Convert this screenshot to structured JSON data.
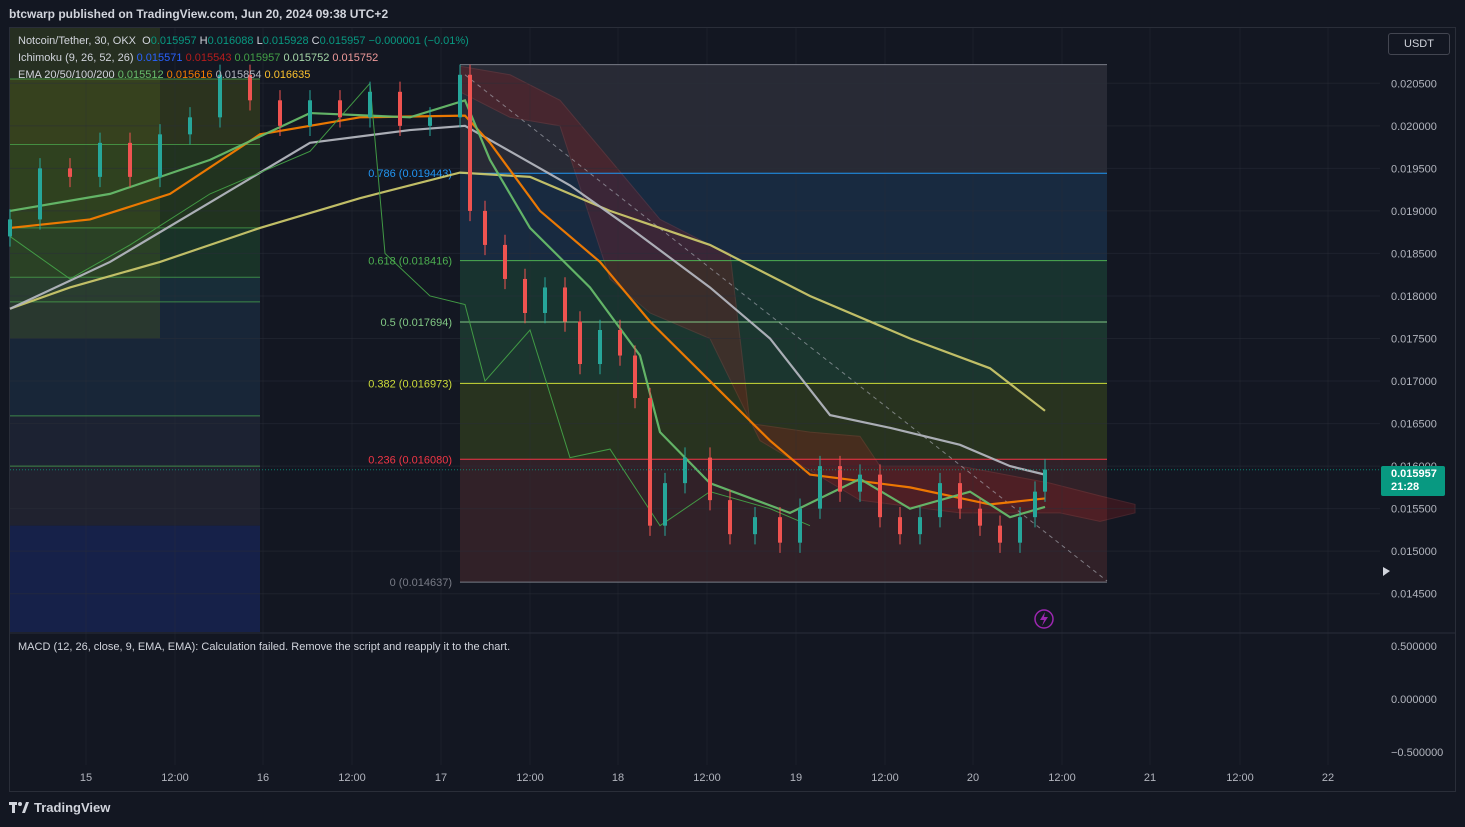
{
  "header": {
    "published_line": "btcwarp published on TradingView.com, Jun 20, 2024 09:38 UTC+2"
  },
  "legend": {
    "symbol": "Notcoin/Tether, 30, OKX",
    "o_label": "O",
    "o_value": "0.015957",
    "h_label": "H",
    "h_value": "0.016088",
    "l_label": "L",
    "l_value": "0.015928",
    "c_label": "C",
    "c_value": "0.015957",
    "change": "−0.000001 (−0.01%)",
    "ichimoku_label": "Ichimoku (9, 26, 52, 26)",
    "ichimoku_values": [
      {
        "v": "0.015571",
        "color": "#2962ff"
      },
      {
        "v": "0.015543",
        "color": "#b71c1c"
      },
      {
        "v": "0.015957",
        "color": "#43a047"
      },
      {
        "v": "0.015752",
        "color": "#a5d6a7"
      },
      {
        "v": "0.015752",
        "color": "#ef9a9a"
      }
    ],
    "ema_label": "EMA 20/50/100/200",
    "ema_values": [
      {
        "v": "0.015512",
        "color": "#66bb6a"
      },
      {
        "v": "0.015616",
        "color": "#f57c00"
      },
      {
        "v": "0.015854",
        "color": "#b2b5be"
      },
      {
        "v": "0.016635",
        "color": "#fbc02d"
      }
    ],
    "macd_text": "MACD (12, 26, close, 9, EMA, EMA): Calculation failed. Remove the script and reapply it to the chart."
  },
  "currency_button": "USDT",
  "last_price": {
    "value": "0.015957",
    "countdown": "21:28",
    "color": "#089981"
  },
  "footer": {
    "logo_text": "TradingView"
  },
  "chart_data": {
    "type": "line",
    "y_axis": {
      "ticks": [
        "0.020500",
        "0.020000",
        "0.019500",
        "0.019000",
        "0.018500",
        "0.018000",
        "0.017500",
        "0.017000",
        "0.016500",
        "0.016000",
        "0.015500",
        "0.015000",
        "0.014500"
      ],
      "tick_values": [
        0.0205,
        0.02,
        0.0195,
        0.019,
        0.0185,
        0.018,
        0.0175,
        0.017,
        0.0165,
        0.016,
        0.0155,
        0.015,
        0.0145
      ],
      "ylim": [
        0.01405,
        0.02115
      ]
    },
    "x_axis": {
      "ticks": [
        "15",
        "12:00",
        "16",
        "12:00",
        "17",
        "12:00",
        "18",
        "12:00",
        "19",
        "12:00",
        "20",
        "12:00",
        "21",
        "12:00",
        "22"
      ]
    },
    "macd_axis": {
      "ticks": [
        "0.500000",
        "0.000000",
        "−0.500000"
      ]
    },
    "fib_left": {
      "levels": [
        0.02055,
        0.01978,
        0.0188,
        0.01822,
        0.01793,
        0.01659,
        0.016,
        0.0153
      ]
    },
    "fib_right": {
      "levels": [
        {
          "ratio": "",
          "label": "",
          "value": 0.02072,
          "color": "#787b86"
        },
        {
          "ratio": "0.786",
          "label": "0.786 (0.019443)",
          "value": 0.019443,
          "color": "#2196f3"
        },
        {
          "ratio": "0.618",
          "label": "0.618 (0.018416)",
          "value": 0.018416,
          "color": "#4caf50"
        },
        {
          "ratio": "0.5",
          "label": "0.5 (0.017694)",
          "value": 0.017694,
          "color": "#81c784"
        },
        {
          "ratio": "0.382",
          "label": "0.382 (0.016973)",
          "value": 0.016973,
          "color": "#cddc39"
        },
        {
          "ratio": "0.236",
          "label": "0.236 (0.016080)",
          "value": 0.01608,
          "color": "#f23645"
        },
        {
          "ratio": "0",
          "label": "0 (0.014637)",
          "value": 0.014637,
          "color": "#787b86"
        }
      ]
    },
    "series": [
      {
        "name": "EMA 200",
        "color": "#c9c66a",
        "points": [
          [
            0,
            0.01785
          ],
          [
            60,
            0.0181
          ],
          [
            150,
            0.0184
          ],
          [
            250,
            0.0188
          ],
          [
            350,
            0.01915
          ],
          [
            450,
            0.01945
          ],
          [
            520,
            0.0194
          ],
          [
            600,
            0.019
          ],
          [
            700,
            0.0186
          ],
          [
            800,
            0.018
          ],
          [
            900,
            0.0175
          ],
          [
            980,
            0.01715
          ],
          [
            1035,
            0.01665
          ]
        ]
      },
      {
        "name": "EMA 100",
        "color": "#b2b5be",
        "points": [
          [
            0,
            0.01785
          ],
          [
            100,
            0.0184
          ],
          [
            200,
            0.0191
          ],
          [
            300,
            0.0198
          ],
          [
            400,
            0.01995
          ],
          [
            455,
            0.02
          ],
          [
            500,
            0.0197
          ],
          [
            560,
            0.0193
          ],
          [
            620,
            0.0188
          ],
          [
            700,
            0.0181
          ],
          [
            760,
            0.0175
          ],
          [
            820,
            0.0166
          ],
          [
            880,
            0.01645
          ],
          [
            950,
            0.01625
          ],
          [
            1000,
            0.016
          ],
          [
            1035,
            0.0159
          ]
        ]
      },
      {
        "name": "EMA 50",
        "color": "#f57c00",
        "points": [
          [
            0,
            0.0188
          ],
          [
            80,
            0.0189
          ],
          [
            160,
            0.0192
          ],
          [
            250,
            0.0199
          ],
          [
            350,
            0.0201
          ],
          [
            455,
            0.02012
          ],
          [
            480,
            0.0198
          ],
          [
            530,
            0.019
          ],
          [
            590,
            0.0184
          ],
          [
            640,
            0.0177
          ],
          [
            700,
            0.017
          ],
          [
            760,
            0.0163
          ],
          [
            800,
            0.0159
          ],
          [
            900,
            0.01575
          ],
          [
            980,
            0.01555
          ],
          [
            1035,
            0.01562
          ]
        ]
      },
      {
        "name": "EMA 20",
        "color": "#66bb6a",
        "points": [
          [
            0,
            0.019
          ],
          [
            100,
            0.0192
          ],
          [
            200,
            0.0196
          ],
          [
            300,
            0.02015
          ],
          [
            400,
            0.0201
          ],
          [
            455,
            0.0203
          ],
          [
            480,
            0.0196
          ],
          [
            520,
            0.0188
          ],
          [
            580,
            0.0181
          ],
          [
            630,
            0.0173
          ],
          [
            650,
            0.0164
          ],
          [
            700,
            0.0158
          ],
          [
            780,
            0.01545
          ],
          [
            850,
            0.01585
          ],
          [
            900,
            0.0155
          ],
          [
            960,
            0.0157
          ],
          [
            1000,
            0.0154
          ],
          [
            1035,
            0.01552
          ]
        ]
      },
      {
        "name": "Ichimoku lagging",
        "color": "#43a047",
        "points": [
          [
            0,
            0.0187
          ],
          [
            60,
            0.0182
          ],
          [
            120,
            0.0186
          ],
          [
            200,
            0.0192
          ],
          [
            300,
            0.0197
          ],
          [
            360,
            0.0205
          ],
          [
            375,
            0.0185
          ],
          [
            420,
            0.018
          ],
          [
            455,
            0.0179
          ],
          [
            475,
            0.017
          ],
          [
            520,
            0.0176
          ],
          [
            560,
            0.0161
          ],
          [
            600,
            0.0162
          ],
          [
            650,
            0.0153
          ],
          [
            700,
            0.0157
          ],
          [
            760,
            0.0155
          ],
          [
            800,
            0.0153
          ]
        ]
      }
    ],
    "candles": [
      {
        "x": 0,
        "o": 0.0187,
        "c": 0.0189
      },
      {
        "x": 30,
        "o": 0.0189,
        "c": 0.0195
      },
      {
        "x": 60,
        "o": 0.0195,
        "c": 0.0194
      },
      {
        "x": 90,
        "o": 0.0194,
        "c": 0.0198
      },
      {
        "x": 120,
        "o": 0.0198,
        "c": 0.0194
      },
      {
        "x": 150,
        "o": 0.0194,
        "c": 0.0199
      },
      {
        "x": 180,
        "o": 0.0199,
        "c": 0.0201
      },
      {
        "x": 210,
        "o": 0.0201,
        "c": 0.0206
      },
      {
        "x": 240,
        "o": 0.0206,
        "c": 0.0203
      },
      {
        "x": 270,
        "o": 0.0203,
        "c": 0.02
      },
      {
        "x": 300,
        "o": 0.02,
        "c": 0.0203
      },
      {
        "x": 330,
        "o": 0.0203,
        "c": 0.0201
      },
      {
        "x": 360,
        "o": 0.0201,
        "c": 0.0204
      },
      {
        "x": 390,
        "o": 0.0204,
        "c": 0.02
      },
      {
        "x": 420,
        "o": 0.02,
        "c": 0.0201
      },
      {
        "x": 450,
        "o": 0.0201,
        "c": 0.0206
      },
      {
        "x": 460,
        "o": 0.0206,
        "c": 0.019
      },
      {
        "x": 475,
        "o": 0.019,
        "c": 0.0186
      },
      {
        "x": 495,
        "o": 0.0186,
        "c": 0.0182
      },
      {
        "x": 515,
        "o": 0.0182,
        "c": 0.0178
      },
      {
        "x": 535,
        "o": 0.0178,
        "c": 0.0181
      },
      {
        "x": 555,
        "o": 0.0181,
        "c": 0.0177
      },
      {
        "x": 570,
        "o": 0.0177,
        "c": 0.0172
      },
      {
        "x": 590,
        "o": 0.0172,
        "c": 0.0176
      },
      {
        "x": 610,
        "o": 0.0176,
        "c": 0.0173
      },
      {
        "x": 625,
        "o": 0.0173,
        "c": 0.0168
      },
      {
        "x": 640,
        "o": 0.0168,
        "c": 0.0153
      },
      {
        "x": 655,
        "o": 0.0153,
        "c": 0.0158
      },
      {
        "x": 675,
        "o": 0.0158,
        "c": 0.0161
      },
      {
        "x": 700,
        "o": 0.0161,
        "c": 0.0156
      },
      {
        "x": 720,
        "o": 0.0156,
        "c": 0.0152
      },
      {
        "x": 745,
        "o": 0.0152,
        "c": 0.0154
      },
      {
        "x": 770,
        "o": 0.0154,
        "c": 0.0151
      },
      {
        "x": 790,
        "o": 0.0151,
        "c": 0.0155
      },
      {
        "x": 810,
        "o": 0.0155,
        "c": 0.016
      },
      {
        "x": 830,
        "o": 0.016,
        "c": 0.0157
      },
      {
        "x": 850,
        "o": 0.0157,
        "c": 0.0159
      },
      {
        "x": 870,
        "o": 0.0159,
        "c": 0.0154
      },
      {
        "x": 890,
        "o": 0.0154,
        "c": 0.0152
      },
      {
        "x": 910,
        "o": 0.0152,
        "c": 0.0154
      },
      {
        "x": 930,
        "o": 0.0154,
        "c": 0.0158
      },
      {
        "x": 950,
        "o": 0.0158,
        "c": 0.0155
      },
      {
        "x": 970,
        "o": 0.0155,
        "c": 0.0153
      },
      {
        "x": 990,
        "o": 0.0153,
        "c": 0.0151
      },
      {
        "x": 1010,
        "o": 0.0151,
        "c": 0.0154
      },
      {
        "x": 1025,
        "o": 0.0154,
        "c": 0.0157
      },
      {
        "x": 1035,
        "o": 0.0157,
        "c": 0.01596
      }
    ]
  }
}
